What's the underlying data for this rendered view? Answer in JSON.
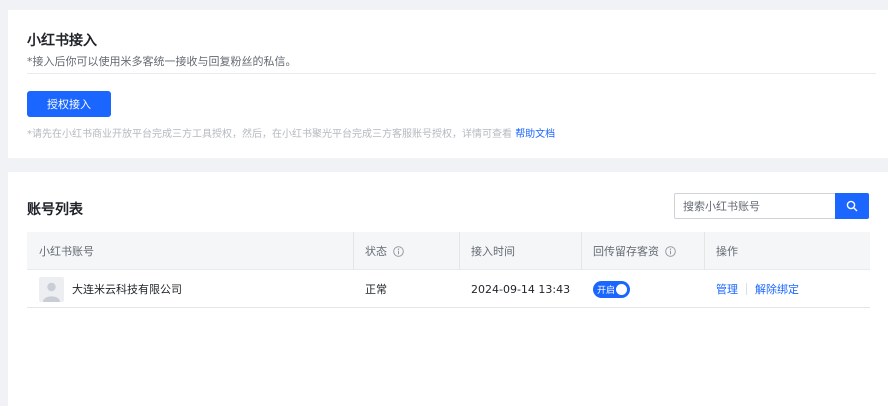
{
  "integration": {
    "title": "小红书接入",
    "description": "*接入后你可以使用米多客统一接收与回复粉丝的私信。",
    "auth_button": "授权接入",
    "hint_text": "*请先在小红书商业开放平台完成三方工具授权，然后，在小红书聚光平台完成三方客服账号授权，详情可查看",
    "help_link": "帮助文档"
  },
  "account_list": {
    "title": "账号列表",
    "search": {
      "placeholder": "搜索小红书账号"
    },
    "columns": {
      "account": "小红书账号",
      "status": "状态",
      "connect_time": "接入时间",
      "retain": "回传留存客资",
      "actions": "操作"
    },
    "rows": [
      {
        "account": "大连米云科技有限公司",
        "status": "正常",
        "connect_time": "2024-09-14 13:43",
        "retain_label": "开启",
        "retain_on": true,
        "action_manage": "管理",
        "action_unbind": "解除绑定"
      }
    ]
  },
  "colors": {
    "primary": "#1a66ff",
    "page_bg": "#f0f2f5",
    "header_bg": "#f5f6f7"
  },
  "icons": {
    "search": "search-icon",
    "info": "info-icon",
    "avatar": "user-avatar-icon"
  }
}
